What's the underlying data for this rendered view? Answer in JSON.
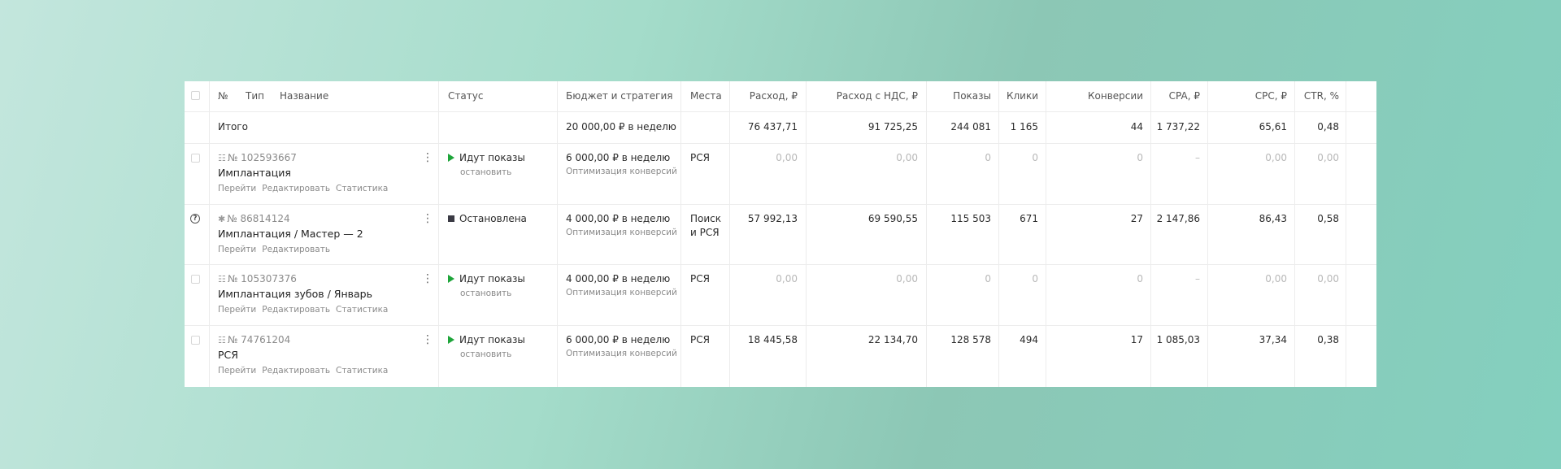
{
  "header": {
    "num": "№",
    "type": "Тип",
    "name": "Название",
    "status": "Статус",
    "budget": "Бюджет и стратегия",
    "places": "Места",
    "spend": "Расход, ₽",
    "spend_vat": "Расход с НДС, ₽",
    "shows": "Показы",
    "clicks": "Клики",
    "conversions": "Конверсии",
    "cpa": "CPA, ₽",
    "cpc": "CPC, ₽",
    "ctr": "CTR, %"
  },
  "total": {
    "label": "Итого",
    "budget": "20 000,00 ₽ в неделю",
    "spend": "76 437,71",
    "spend_vat": "91 725,25",
    "shows": "244 081",
    "clicks": "1 165",
    "conversions": "44",
    "cpa": "1 737,22",
    "cpc": "65,61",
    "ctr": "0,48"
  },
  "rows": [
    {
      "id": "№ 102593667",
      "type_icon": "text-ad-icon",
      "name": "Имплантация",
      "links": [
        "Перейти",
        "Редактировать",
        "Статистика"
      ],
      "status": "Идут показы",
      "status_action": "остановить",
      "budget": "6 000,00 ₽ в неделю",
      "strategy": "Оптимизация конверсий",
      "places": [
        "РСЯ"
      ],
      "spend": "0,00",
      "spend_vat": "0,00",
      "shows": "0",
      "clicks": "0",
      "conversions": "0",
      "cpa": "–",
      "cpc": "0,00",
      "ctr": "0,00"
    },
    {
      "id": "№ 86814124",
      "type_icon": "master-campaign-icon",
      "name": "Имплантация / Мастер — 2",
      "links": [
        "Перейти",
        "Редактировать"
      ],
      "status": "Остановлена",
      "status_action": "",
      "budget": "4 000,00 ₽ в неделю",
      "strategy": "Оптимизация конверсий",
      "places": [
        "Поиск",
        "и РСЯ"
      ],
      "spend": "57 992,13",
      "spend_vat": "69 590,55",
      "shows": "115 503",
      "clicks": "671",
      "conversions": "27",
      "cpa": "2 147,86",
      "cpc": "86,43",
      "ctr": "0,58"
    },
    {
      "id": "№ 105307376",
      "type_icon": "text-ad-icon",
      "name": "Имплантация зубов / Январь",
      "links": [
        "Перейти",
        "Редактировать",
        "Статистика"
      ],
      "status": "Идут показы",
      "status_action": "остановить",
      "budget": "4 000,00 ₽ в неделю",
      "strategy": "Оптимизация конверсий",
      "places": [
        "РСЯ"
      ],
      "spend": "0,00",
      "spend_vat": "0,00",
      "shows": "0",
      "clicks": "0",
      "conversions": "0",
      "cpa": "–",
      "cpc": "0,00",
      "ctr": "0,00"
    },
    {
      "id": "№ 74761204",
      "type_icon": "text-ad-icon",
      "name": "РСЯ",
      "links": [
        "Перейти",
        "Редактировать",
        "Статистика"
      ],
      "status": "Идут показы",
      "status_action": "остановить",
      "budget": "6 000,00 ₽ в неделю",
      "strategy": "Оптимизация конверсий",
      "places": [
        "РСЯ"
      ],
      "spend": "18 445,58",
      "spend_vat": "22 134,70",
      "shows": "128 578",
      "clicks": "494",
      "conversions": "17",
      "cpa": "1 085,03",
      "cpc": "37,34",
      "ctr": "0,38"
    }
  ]
}
